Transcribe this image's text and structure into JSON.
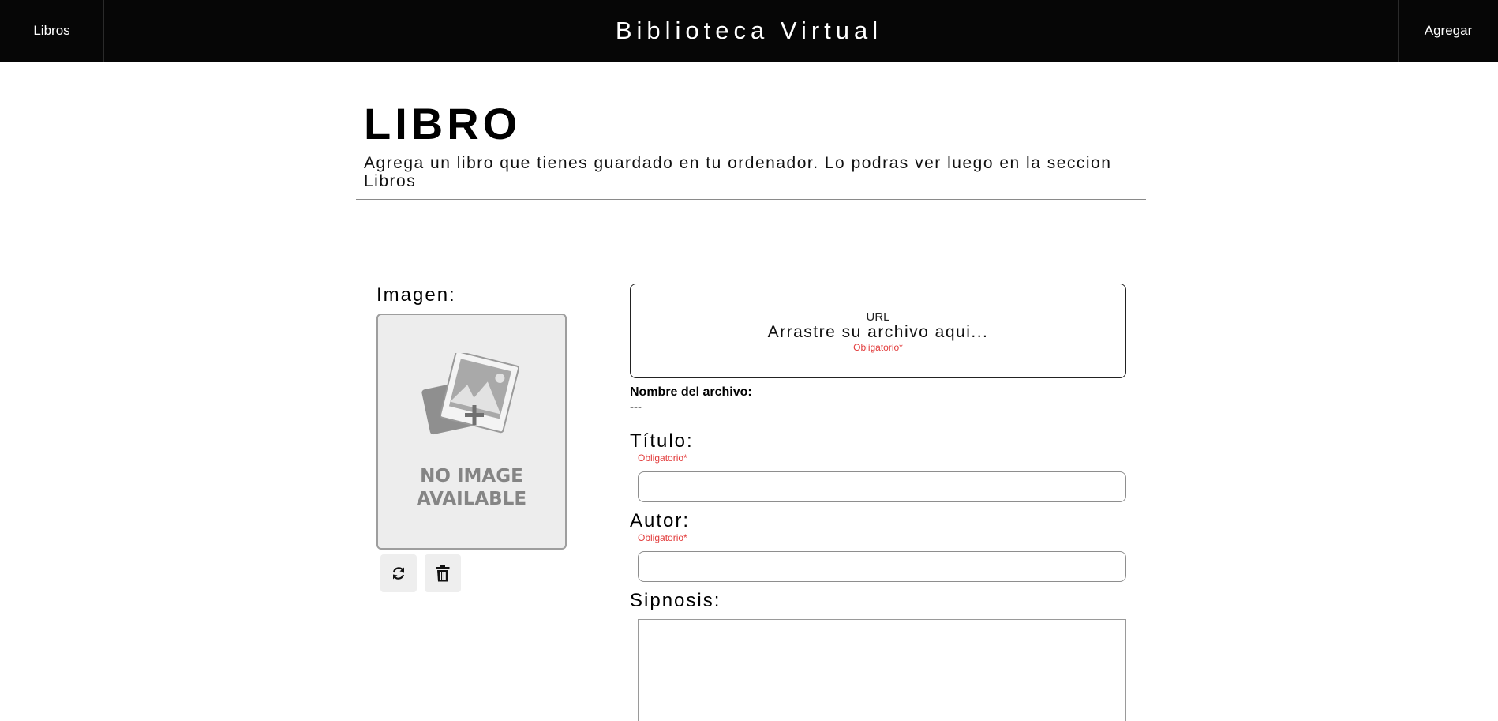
{
  "header": {
    "nav_left": "Libros",
    "title": "Biblioteca Virtual",
    "nav_right": "Agregar"
  },
  "page": {
    "title": "LIBRO",
    "subtitle": "Agrega un libro que tienes guardado en tu ordenador. Lo podras ver luego en la seccion Libros"
  },
  "image_panel": {
    "label": "Imagen:",
    "placeholder_line1": "NO IMAGE",
    "placeholder_line2": "AVAILABLE",
    "refresh_icon": "refresh-icon",
    "delete_icon": "trash-icon"
  },
  "dropzone": {
    "url_label": "URL",
    "text": "Arrastre su archivo aqui...",
    "required": "Obligatorio*"
  },
  "file": {
    "label": "Nombre del archivo:",
    "value": "---"
  },
  "fields": {
    "titulo": {
      "label": "Título:",
      "required": "Obligatorio*",
      "value": ""
    },
    "autor": {
      "label": "Autor:",
      "required": "Obligatorio*",
      "value": ""
    },
    "sipnosis": {
      "label": "Sipnosis:",
      "value": ""
    }
  },
  "colors": {
    "header_bg": "#060606",
    "required_text": "#e23b3b",
    "placeholder_bg": "#ededed"
  }
}
